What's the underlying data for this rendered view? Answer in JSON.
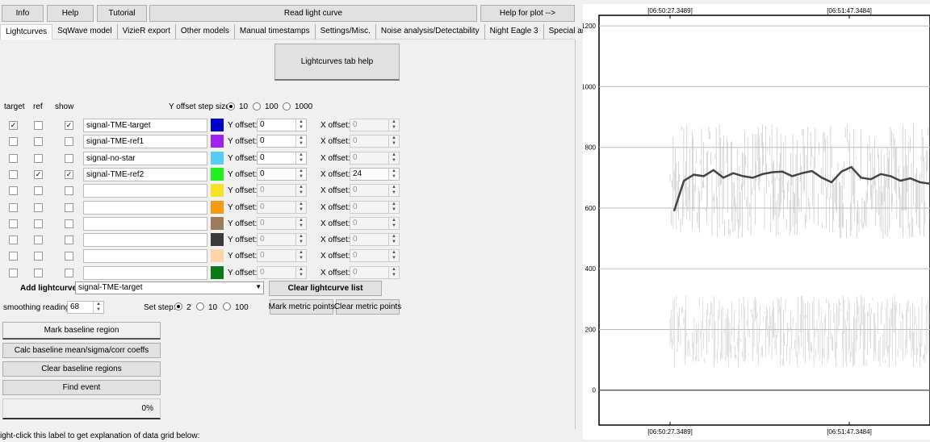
{
  "toolbar": {
    "info": "Info",
    "help": "Help",
    "tutorial": "Tutorial",
    "read_light_curve": "Read light curve",
    "help_for_plot": "Help for plot -->"
  },
  "tabs": [
    "Lightcurves",
    "SqWave model",
    "VizieR export",
    "Other models",
    "Manual timestamps",
    "Settings/Misc.",
    "Noise analysis/Detectability",
    "Night Eagle 3",
    "Special analysis"
  ],
  "lightcurves_tab_help": "Lightcurves tab help",
  "grid_headers": {
    "target": "target",
    "ref": "ref",
    "show": "show"
  },
  "y_offset_step": {
    "label": "Y offset step size:",
    "options": [
      "10",
      "100",
      "1000"
    ],
    "selected": "10"
  },
  "y_offset_label": "Y offset:",
  "x_offset_label": "X offset:",
  "rows": [
    {
      "target": true,
      "ref": false,
      "show": true,
      "name": "signal-TME-target",
      "color": "#0000cc",
      "y": "0",
      "x": "0",
      "x_enabled": false,
      "y_enabled": true
    },
    {
      "target": false,
      "ref": false,
      "show": false,
      "name": "signal-TME-ref1",
      "color": "#a020f0",
      "y": "0",
      "x": "0",
      "x_enabled": false,
      "y_enabled": true
    },
    {
      "target": false,
      "ref": false,
      "show": false,
      "name": "signal-no-star",
      "color": "#56ccf2",
      "y": "0",
      "x": "0",
      "x_enabled": false,
      "y_enabled": true
    },
    {
      "target": false,
      "ref": true,
      "show": true,
      "name": "signal-TME-ref2",
      "color": "#22ee22",
      "y": "0",
      "x": "24",
      "x_enabled": true,
      "y_enabled": true
    },
    {
      "target": false,
      "ref": false,
      "show": false,
      "name": "",
      "color": "#f5e125",
      "y": "0",
      "x": "0",
      "x_enabled": false,
      "y_enabled": false
    },
    {
      "target": false,
      "ref": false,
      "show": false,
      "name": "",
      "color": "#f59a11",
      "y": "0",
      "x": "0",
      "x_enabled": false,
      "y_enabled": false
    },
    {
      "target": false,
      "ref": false,
      "show": false,
      "name": "",
      "color": "#9c7a5c",
      "y": "0",
      "x": "0",
      "x_enabled": false,
      "y_enabled": false
    },
    {
      "target": false,
      "ref": false,
      "show": false,
      "name": "",
      "color": "#3a3a3a",
      "y": "0",
      "x": "0",
      "x_enabled": false,
      "y_enabled": false
    },
    {
      "target": false,
      "ref": false,
      "show": false,
      "name": "",
      "color": "#fdd5a7",
      "y": "0",
      "x": "0",
      "x_enabled": false,
      "y_enabled": false
    },
    {
      "target": false,
      "ref": false,
      "show": false,
      "name": "",
      "color": "#0c7a14",
      "y": "0",
      "x": "0",
      "x_enabled": false,
      "y_enabled": false
    }
  ],
  "add_lightcurve": {
    "label": "Add lightcurve",
    "value": "signal-TME-target"
  },
  "clear_lightcurve_list": "Clear lightcurve list",
  "smoothing": {
    "label": "smoothing readings",
    "value": "68"
  },
  "set_step": {
    "label": "Set step:",
    "options": [
      "2",
      "10",
      "100"
    ],
    "selected": "2"
  },
  "mark_metric_points": "Mark metric points",
  "clear_metric_points": "Clear metric points",
  "mark_baseline_region": "Mark baseline region",
  "calc_baseline": "Calc baseline mean/sigma/corr coeffs",
  "clear_baseline_regions": "Clear baseline regions",
  "find_event": "Find event",
  "progress": {
    "percent_text": "0%",
    "value": 0
  },
  "status_bar": "ight-click this label to get explanation of data grid below:",
  "plot": {
    "top_ticks": [
      "[06:50:27.3489]",
      "[06:51:47.3484]"
    ],
    "bottom_ticks": [
      "[06:50:27.3489]",
      "[06:51:47.3484]"
    ],
    "y_ticks": [
      "1200",
      "1000",
      "800",
      "600",
      "400",
      "200",
      "0"
    ],
    "y_range": [
      -115,
      1235
    ]
  }
}
